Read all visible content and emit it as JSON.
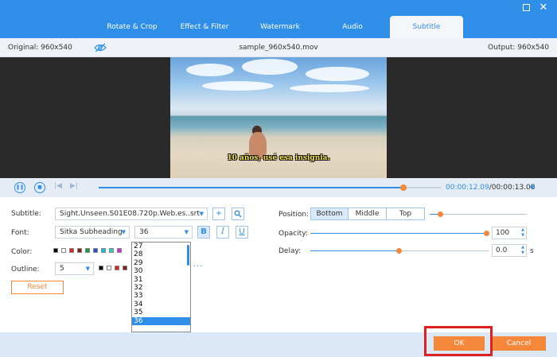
{
  "tabs": [
    {
      "label": "Rotate & Crop"
    },
    {
      "label": "Effect & Filter"
    },
    {
      "label": "Watermark"
    },
    {
      "label": "Audio"
    },
    {
      "label": "Subtitle"
    }
  ],
  "active_tab": "Subtitle",
  "info": {
    "original": "Original: 960x540",
    "filename": "sample_960x540.mov",
    "output": "Output: 960x540"
  },
  "video": {
    "subtitle_overlay": "10 años, usé esa insignia."
  },
  "playback": {
    "current_time": "00:00:12.09",
    "total_time": "/00:00:13.08",
    "progress": 0.89
  },
  "settings": {
    "subtitle_label": "Subtitle:",
    "subtitle_file": "Sight.Unseen.S01E08.720p.Web.es..srt",
    "font_label": "Font:",
    "font_name": "Sitka Subheading",
    "font_size": "36",
    "bold_label": "B",
    "italic_label": "I",
    "underline_label": "U",
    "color_label": "Color:",
    "outline_label": "Outline:",
    "outline_value": "5",
    "more_label": "···",
    "reset_label": "Reset",
    "position_label": "Position:",
    "position_options": [
      "Bottom",
      "Middle",
      "Top"
    ],
    "position_selected": "Bottom",
    "opacity_label": "Opacity:",
    "opacity_value": "100",
    "delay_label": "Delay:",
    "delay_value": "0.0",
    "delay_unit": "s"
  },
  "colors": {
    "swatches": [
      "#000000",
      "#ffffff",
      "#e02020",
      "#8b1a1a",
      "#1a9e3a",
      "#1f4fd1",
      "#1bbcd6",
      "#30c8c8",
      "#d030d0"
    ],
    "outline_swatches": [
      "#000000",
      "#ffffff",
      "#e02020",
      "#8b1a1a"
    ],
    "accent": "#2f8fe8",
    "action": "#f5873a"
  },
  "font_size_options": [
    "27",
    "28",
    "29",
    "30",
    "31",
    "32",
    "33",
    "34",
    "35",
    "36"
  ],
  "font_size_selected": "36",
  "footer": {
    "ok_label": "OK",
    "cancel_label": "Cancel"
  }
}
